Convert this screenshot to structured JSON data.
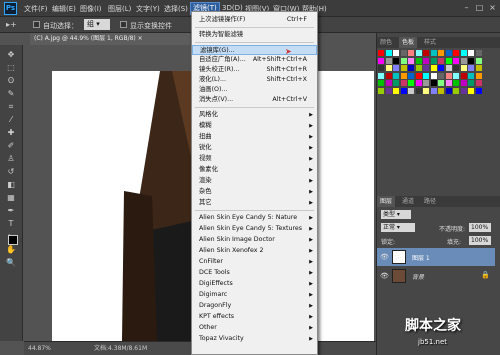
{
  "app": {
    "logo": "Ps"
  },
  "menubar": [
    "文件(F)",
    "编辑(E)",
    "图像(I)",
    "图层(L)",
    "文字(Y)",
    "选择(S)",
    "滤镜(T)",
    "3D(D)",
    "视图(V)",
    "窗口(W)",
    "帮助(H)"
  ],
  "options": {
    "auto_select": "自动选择：",
    "group": "组",
    "show_transform": "显示变换控件"
  },
  "doc_tab": "(C) A.jpg @ 44.9% (图层 1, RGB/8) ×",
  "status": {
    "zoom": "44.87%",
    "doc": "文档:4.38M/8.61M"
  },
  "filter_menu": {
    "items": [
      {
        "label": "上次滤镜操作(F)",
        "shortcut": "Ctrl+F"
      },
      {
        "label": "转换为智能滤镜",
        "shortcut": ""
      },
      {
        "label": "滤镜库(G)...",
        "shortcut": "",
        "highlighted": true
      },
      {
        "label": "自适应广角(A)...",
        "shortcut": "Alt+Shift+Ctrl+A"
      },
      {
        "label": "镜头校正(R)...",
        "shortcut": "Shift+Ctrl+R"
      },
      {
        "label": "液化(L)...",
        "shortcut": "Shift+Ctrl+X"
      },
      {
        "label": "油画(O)...",
        "shortcut": ""
      },
      {
        "label": "消失点(V)...",
        "shortcut": "Alt+Ctrl+V"
      },
      {
        "label": "风格化",
        "sub": true
      },
      {
        "label": "模糊",
        "sub": true
      },
      {
        "label": "扭曲",
        "sub": true
      },
      {
        "label": "锐化",
        "sub": true
      },
      {
        "label": "视频",
        "sub": true
      },
      {
        "label": "像素化",
        "sub": true
      },
      {
        "label": "渲染",
        "sub": true
      },
      {
        "label": "杂色",
        "sub": true
      },
      {
        "label": "其它",
        "sub": true
      },
      {
        "label": "Alien Skin Eye Candy 5: Nature",
        "sub": true
      },
      {
        "label": "Alien Skin Eye Candy 5: Textures",
        "sub": true
      },
      {
        "label": "Alien Skin Image Doctor",
        "sub": true
      },
      {
        "label": "Alien Skin Xenofex 2",
        "sub": true
      },
      {
        "label": "CnFilter",
        "sub": true
      },
      {
        "label": "DCE Tools",
        "sub": true
      },
      {
        "label": "DigiEffects",
        "sub": true
      },
      {
        "label": "Digimarc",
        "sub": true
      },
      {
        "label": "DragonFly",
        "sub": true
      },
      {
        "label": "KPT effects",
        "sub": true
      },
      {
        "label": "Other",
        "sub": true
      },
      {
        "label": "Topaz Vivacity",
        "sub": true
      }
    ]
  },
  "panels": {
    "top_tabs": [
      "颜色",
      "色板",
      "样式"
    ],
    "layer_tabs": [
      "图层",
      "通道",
      "路径"
    ],
    "kind": "类型",
    "blend": "正常",
    "opacity_label": "不透明度:",
    "opacity": "100%",
    "lock_label": "锁定:",
    "fill_label": "填充:",
    "fill": "100%",
    "layers": [
      {
        "name": "图层 1"
      },
      {
        "name": "背景"
      }
    ]
  },
  "watermark": {
    "main": "脚本之家",
    "url": "jb51.net"
  }
}
